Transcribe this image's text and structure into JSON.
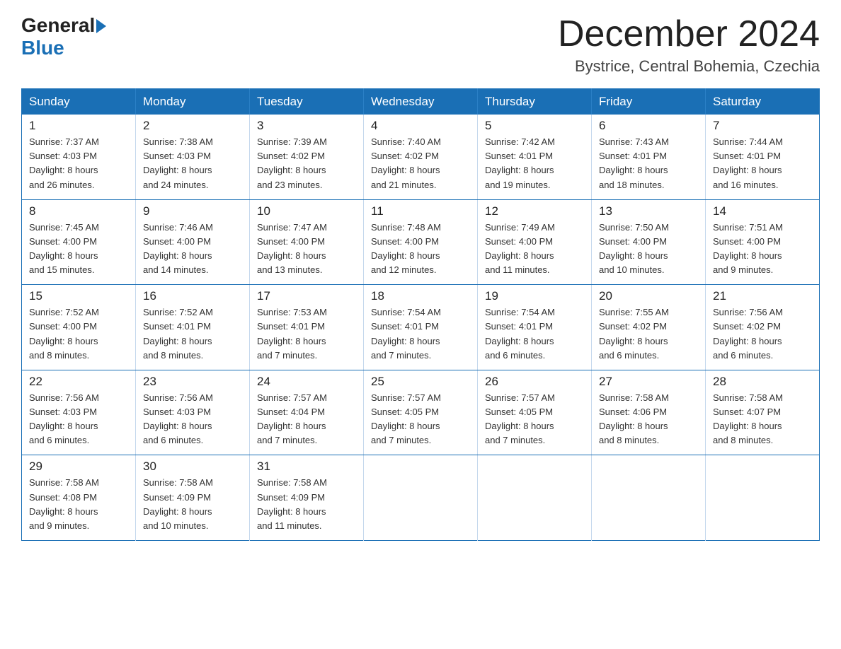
{
  "logo": {
    "general": "General",
    "blue": "Blue"
  },
  "title": {
    "month": "December 2024",
    "location": "Bystrice, Central Bohemia, Czechia"
  },
  "weekdays": [
    "Sunday",
    "Monday",
    "Tuesday",
    "Wednesday",
    "Thursday",
    "Friday",
    "Saturday"
  ],
  "weeks": [
    [
      {
        "day": "1",
        "sunrise": "7:37 AM",
        "sunset": "4:03 PM",
        "daylight": "8 hours and 26 minutes."
      },
      {
        "day": "2",
        "sunrise": "7:38 AM",
        "sunset": "4:03 PM",
        "daylight": "8 hours and 24 minutes."
      },
      {
        "day": "3",
        "sunrise": "7:39 AM",
        "sunset": "4:02 PM",
        "daylight": "8 hours and 23 minutes."
      },
      {
        "day": "4",
        "sunrise": "7:40 AM",
        "sunset": "4:02 PM",
        "daylight": "8 hours and 21 minutes."
      },
      {
        "day": "5",
        "sunrise": "7:42 AM",
        "sunset": "4:01 PM",
        "daylight": "8 hours and 19 minutes."
      },
      {
        "day": "6",
        "sunrise": "7:43 AM",
        "sunset": "4:01 PM",
        "daylight": "8 hours and 18 minutes."
      },
      {
        "day": "7",
        "sunrise": "7:44 AM",
        "sunset": "4:01 PM",
        "daylight": "8 hours and 16 minutes."
      }
    ],
    [
      {
        "day": "8",
        "sunrise": "7:45 AM",
        "sunset": "4:00 PM",
        "daylight": "8 hours and 15 minutes."
      },
      {
        "day": "9",
        "sunrise": "7:46 AM",
        "sunset": "4:00 PM",
        "daylight": "8 hours and 14 minutes."
      },
      {
        "day": "10",
        "sunrise": "7:47 AM",
        "sunset": "4:00 PM",
        "daylight": "8 hours and 13 minutes."
      },
      {
        "day": "11",
        "sunrise": "7:48 AM",
        "sunset": "4:00 PM",
        "daylight": "8 hours and 12 minutes."
      },
      {
        "day": "12",
        "sunrise": "7:49 AM",
        "sunset": "4:00 PM",
        "daylight": "8 hours and 11 minutes."
      },
      {
        "day": "13",
        "sunrise": "7:50 AM",
        "sunset": "4:00 PM",
        "daylight": "8 hours and 10 minutes."
      },
      {
        "day": "14",
        "sunrise": "7:51 AM",
        "sunset": "4:00 PM",
        "daylight": "8 hours and 9 minutes."
      }
    ],
    [
      {
        "day": "15",
        "sunrise": "7:52 AM",
        "sunset": "4:00 PM",
        "daylight": "8 hours and 8 minutes."
      },
      {
        "day": "16",
        "sunrise": "7:52 AM",
        "sunset": "4:01 PM",
        "daylight": "8 hours and 8 minutes."
      },
      {
        "day": "17",
        "sunrise": "7:53 AM",
        "sunset": "4:01 PM",
        "daylight": "8 hours and 7 minutes."
      },
      {
        "day": "18",
        "sunrise": "7:54 AM",
        "sunset": "4:01 PM",
        "daylight": "8 hours and 7 minutes."
      },
      {
        "day": "19",
        "sunrise": "7:54 AM",
        "sunset": "4:01 PM",
        "daylight": "8 hours and 6 minutes."
      },
      {
        "day": "20",
        "sunrise": "7:55 AM",
        "sunset": "4:02 PM",
        "daylight": "8 hours and 6 minutes."
      },
      {
        "day": "21",
        "sunrise": "7:56 AM",
        "sunset": "4:02 PM",
        "daylight": "8 hours and 6 minutes."
      }
    ],
    [
      {
        "day": "22",
        "sunrise": "7:56 AM",
        "sunset": "4:03 PM",
        "daylight": "8 hours and 6 minutes."
      },
      {
        "day": "23",
        "sunrise": "7:56 AM",
        "sunset": "4:03 PM",
        "daylight": "8 hours and 6 minutes."
      },
      {
        "day": "24",
        "sunrise": "7:57 AM",
        "sunset": "4:04 PM",
        "daylight": "8 hours and 7 minutes."
      },
      {
        "day": "25",
        "sunrise": "7:57 AM",
        "sunset": "4:05 PM",
        "daylight": "8 hours and 7 minutes."
      },
      {
        "day": "26",
        "sunrise": "7:57 AM",
        "sunset": "4:05 PM",
        "daylight": "8 hours and 7 minutes."
      },
      {
        "day": "27",
        "sunrise": "7:58 AM",
        "sunset": "4:06 PM",
        "daylight": "8 hours and 8 minutes."
      },
      {
        "day": "28",
        "sunrise": "7:58 AM",
        "sunset": "4:07 PM",
        "daylight": "8 hours and 8 minutes."
      }
    ],
    [
      {
        "day": "29",
        "sunrise": "7:58 AM",
        "sunset": "4:08 PM",
        "daylight": "8 hours and 9 minutes."
      },
      {
        "day": "30",
        "sunrise": "7:58 AM",
        "sunset": "4:09 PM",
        "daylight": "8 hours and 10 minutes."
      },
      {
        "day": "31",
        "sunrise": "7:58 AM",
        "sunset": "4:09 PM",
        "daylight": "8 hours and 11 minutes."
      },
      null,
      null,
      null,
      null
    ]
  ],
  "labels": {
    "sunrise": "Sunrise:",
    "sunset": "Sunset:",
    "daylight": "Daylight:"
  }
}
